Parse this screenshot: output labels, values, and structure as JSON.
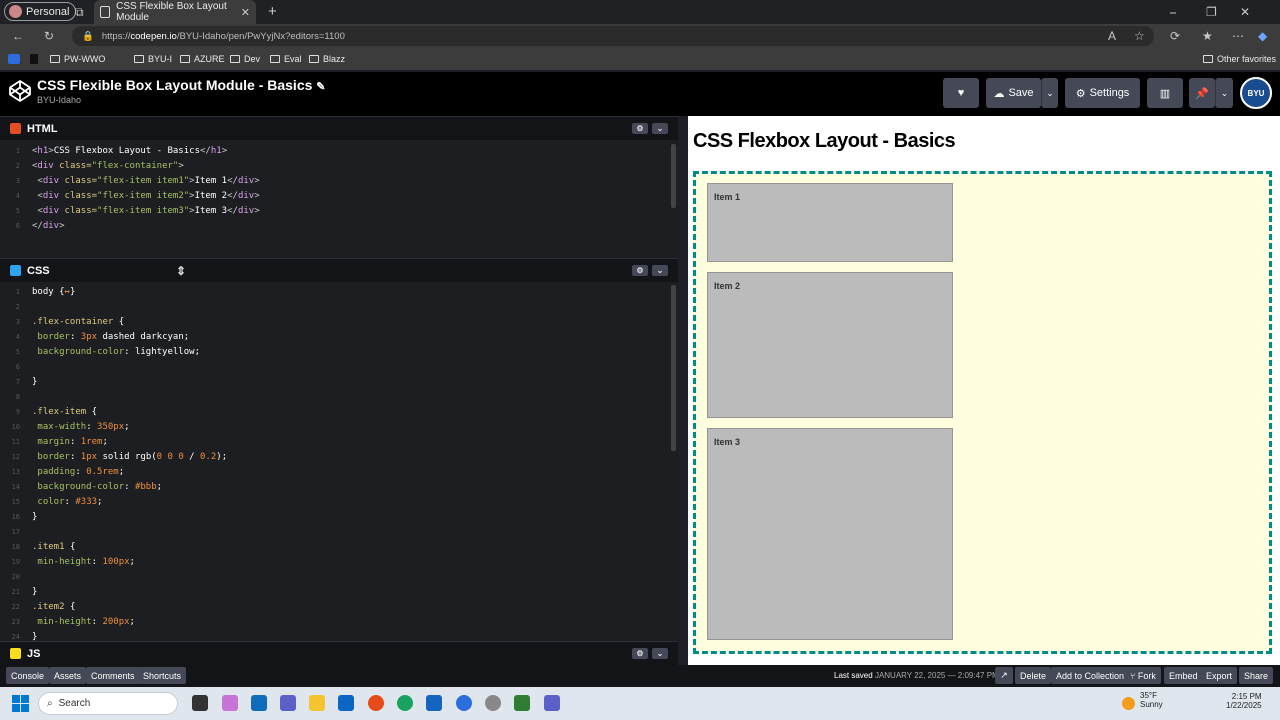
{
  "browser": {
    "profile": "Personal",
    "tab_title": "CSS Flexible Box Layout Module",
    "url_prefix": "https://",
    "url_host": "codepen.io",
    "url_path": "/BYU-Idaho/pen/PwYyjNx?editors=1100",
    "bookmarks": [
      "PW-WWO",
      "BYU-I",
      "AZURE",
      "Dev",
      "Eval",
      "Blazz"
    ],
    "other_favorites": "Other favorites"
  },
  "codepen": {
    "title": "CSS Flexible Box Layout Module - Basics",
    "owner": "BYU-Idaho",
    "save_label": "Save",
    "settings_label": "Settings",
    "avatar_text": "BYU"
  },
  "editors": {
    "html_label": "HTML",
    "css_label": "CSS",
    "js_label": "JS",
    "html_lines": [
      {
        "n": "1",
        "parts": [
          [
            "t-tag",
            "<"
          ],
          [
            "t-tagn",
            "h1"
          ],
          [
            "t-tag",
            ">"
          ],
          [
            "t-kw",
            "CSS Flexbox Layout - Basics"
          ],
          [
            "t-tag",
            "</"
          ],
          [
            "t-tagn",
            "h1"
          ],
          [
            "t-tag",
            ">"
          ]
        ]
      },
      {
        "n": "2",
        "parts": [
          [
            "t-tag",
            "<"
          ],
          [
            "t-tagn",
            "div "
          ],
          [
            "t-attr",
            "class="
          ],
          [
            "t-str",
            "\"flex-container\""
          ],
          [
            "t-tag",
            ">"
          ]
        ]
      },
      {
        "n": "3",
        "parts": [
          [
            "t-tag",
            " <"
          ],
          [
            "t-tagn",
            "div "
          ],
          [
            "t-attr",
            "class="
          ],
          [
            "t-str",
            "\"flex-item item1\""
          ],
          [
            "t-tag",
            ">"
          ],
          [
            "t-kw",
            "Item 1"
          ],
          [
            "t-tag",
            "</"
          ],
          [
            "t-tagn",
            "div"
          ],
          [
            "t-tag",
            ">"
          ]
        ]
      },
      {
        "n": "4",
        "parts": [
          [
            "t-tag",
            " <"
          ],
          [
            "t-tagn",
            "div "
          ],
          [
            "t-attr",
            "class="
          ],
          [
            "t-str",
            "\"flex-item item2\""
          ],
          [
            "t-tag",
            ">"
          ],
          [
            "t-kw",
            "Item 2"
          ],
          [
            "t-tag",
            "</"
          ],
          [
            "t-tagn",
            "div"
          ],
          [
            "t-tag",
            ">"
          ]
        ]
      },
      {
        "n": "5",
        "parts": [
          [
            "t-tag",
            " <"
          ],
          [
            "t-tagn",
            "div "
          ],
          [
            "t-attr",
            "class="
          ],
          [
            "t-str",
            "\"flex-item item3\""
          ],
          [
            "t-tag",
            ">"
          ],
          [
            "t-kw",
            "Item 3"
          ],
          [
            "t-tag",
            "</"
          ],
          [
            "t-tagn",
            "div"
          ],
          [
            "t-tag",
            ">"
          ]
        ]
      },
      {
        "n": "6",
        "parts": [
          [
            "t-tag",
            "</"
          ],
          [
            "t-tagn",
            "div"
          ],
          [
            "t-tag",
            ">"
          ]
        ]
      }
    ],
    "css_lines": [
      {
        "n": "1",
        "parts": [
          [
            "t-kw",
            "body "
          ],
          [
            "t-kw",
            "{"
          ],
          [
            "t-num",
            "↔"
          ],
          [
            "t-kw",
            "}"
          ]
        ]
      },
      {
        "n": "2",
        "parts": []
      },
      {
        "n": "3",
        "parts": [
          [
            "t-sel",
            ".flex-container "
          ],
          [
            "t-kw",
            "{"
          ]
        ]
      },
      {
        "n": "4",
        "parts": [
          [
            "t-prop",
            " border"
          ],
          [
            "t-kw",
            ": "
          ],
          [
            "t-num",
            "3px"
          ],
          [
            "t-kw",
            " dashed darkcyan;"
          ]
        ]
      },
      {
        "n": "5",
        "parts": [
          [
            "t-prop",
            " background-color"
          ],
          [
            "t-kw",
            ": lightyellow;"
          ]
        ]
      },
      {
        "n": "6",
        "parts": []
      },
      {
        "n": "7",
        "parts": [
          [
            "t-kw",
            "}"
          ]
        ]
      },
      {
        "n": "8",
        "parts": []
      },
      {
        "n": "9",
        "parts": [
          [
            "t-sel",
            ".flex-item "
          ],
          [
            "t-kw",
            "{"
          ]
        ]
      },
      {
        "n": "10",
        "parts": [
          [
            "t-prop",
            " max-width"
          ],
          [
            "t-kw",
            ": "
          ],
          [
            "t-num",
            "350px"
          ],
          [
            "t-kw",
            ";"
          ]
        ]
      },
      {
        "n": "11",
        "parts": [
          [
            "t-prop",
            " margin"
          ],
          [
            "t-kw",
            ": "
          ],
          [
            "t-num",
            "1rem"
          ],
          [
            "t-kw",
            ";"
          ]
        ]
      },
      {
        "n": "12",
        "parts": [
          [
            "t-prop",
            " border"
          ],
          [
            "t-kw",
            ": "
          ],
          [
            "t-num",
            "1px"
          ],
          [
            "t-kw",
            " solid rgb("
          ],
          [
            "t-num",
            "0 0 0"
          ],
          [
            "t-kw",
            " / "
          ],
          [
            "t-num",
            "0.2"
          ],
          [
            "t-kw",
            ");"
          ]
        ]
      },
      {
        "n": "13",
        "parts": [
          [
            "t-prop",
            " padding"
          ],
          [
            "t-kw",
            ": "
          ],
          [
            "t-num",
            "0.5rem"
          ],
          [
            "t-kw",
            ";"
          ]
        ]
      },
      {
        "n": "14",
        "parts": [
          [
            "t-prop",
            " background-color"
          ],
          [
            "t-kw",
            ": "
          ],
          [
            "t-num",
            "#bbb"
          ],
          [
            "t-kw",
            ";"
          ]
        ]
      },
      {
        "n": "15",
        "parts": [
          [
            "t-prop",
            " color"
          ],
          [
            "t-kw",
            ": "
          ],
          [
            "t-num",
            "#333"
          ],
          [
            "t-kw",
            ";"
          ]
        ]
      },
      {
        "n": "16",
        "parts": [
          [
            "t-kw",
            "}"
          ]
        ]
      },
      {
        "n": "17",
        "parts": []
      },
      {
        "n": "18",
        "parts": [
          [
            "t-sel",
            ".item1 "
          ],
          [
            "t-kw",
            "{"
          ]
        ]
      },
      {
        "n": "19",
        "parts": [
          [
            "t-prop",
            " min-height"
          ],
          [
            "t-kw",
            ": "
          ],
          [
            "t-num",
            "100px"
          ],
          [
            "t-kw",
            ";"
          ]
        ]
      },
      {
        "n": "20",
        "parts": []
      },
      {
        "n": "21",
        "parts": [
          [
            "t-kw",
            "}"
          ]
        ]
      },
      {
        "n": "22",
        "parts": [
          [
            "t-sel",
            ".item2 "
          ],
          [
            "t-kw",
            "{"
          ]
        ]
      },
      {
        "n": "23",
        "parts": [
          [
            "t-prop",
            " min-height"
          ],
          [
            "t-kw",
            ": "
          ],
          [
            "t-num",
            "200px"
          ],
          [
            "t-kw",
            ";"
          ]
        ]
      },
      {
        "n": "24",
        "parts": [
          [
            "t-kw",
            "}"
          ]
        ]
      }
    ]
  },
  "result": {
    "heading": "CSS Flexbox Layout - Basics",
    "items": [
      "Item 1",
      "Item 2",
      "Item 3"
    ]
  },
  "footer": {
    "left_buttons": [
      "Console",
      "Assets",
      "Comments",
      "Shortcuts"
    ],
    "saved_label": "Last saved",
    "saved_time": "JANUARY 22, 2025 — 2:09:47 PM",
    "right_buttons": [
      "Delete",
      "Add to Collection",
      "Fork",
      "Embed",
      "Export",
      "Share"
    ]
  },
  "taskbar": {
    "search_placeholder": "Search",
    "temperature": "35°F",
    "condition": "Sunny",
    "time": "2:15 PM",
    "date": "1/22/2025"
  }
}
